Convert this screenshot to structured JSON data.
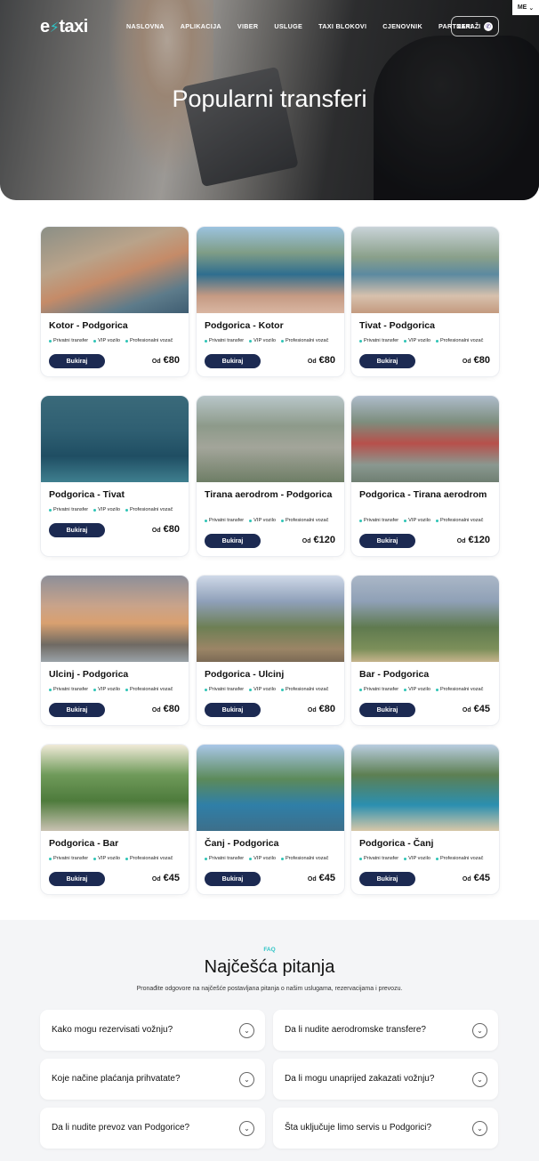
{
  "brand": {
    "logo_prefix": "e",
    "logo_suffix": "taxi",
    "accent": "#2ec4c6",
    "navy": "#1c2a52"
  },
  "nav": {
    "items": [
      "NASLOVNA",
      "APLIKACIJA",
      "VIBER",
      "USLUGE",
      "TAXI BLOKOVI",
      "CJENOVNIK",
      "PARTNERI"
    ],
    "order_label": "ZAKAŽI",
    "order_icon": "viber-icon",
    "language": "ME"
  },
  "hero": {
    "title": "Popularni transferi"
  },
  "transfers": [
    {
      "route": "Kotor - Podgorica",
      "price_prefix": "Od",
      "price": "€80"
    },
    {
      "route": "Podgorica - Kotor",
      "price_prefix": "Od",
      "price": "€80"
    },
    {
      "route": "Tivat - Podgorica",
      "price_prefix": "Od",
      "price": "€80"
    },
    {
      "route": "Podgorica - Tivat",
      "price_prefix": "Od",
      "price": "€80"
    },
    {
      "route": "Tirana aerodrom - Podgorica",
      "price_prefix": "Od",
      "price": "€120"
    },
    {
      "route": "Podgorica - Tirana aerodrom",
      "price_prefix": "Od",
      "price": "€120"
    },
    {
      "route": "Ulcinj - Podgorica",
      "price_prefix": "Od",
      "price": "€80"
    },
    {
      "route": "Podgorica - Ulcinj",
      "price_prefix": "Od",
      "price": "€80"
    },
    {
      "route": "Bar - Podgorica",
      "price_prefix": "Od",
      "price": "€45"
    },
    {
      "route": "Podgorica - Bar",
      "price_prefix": "Od",
      "price": "€45"
    },
    {
      "route": "Čanj - Podgorica",
      "price_prefix": "Od",
      "price": "€45"
    },
    {
      "route": "Podgorica - Čanj",
      "price_prefix": "Od",
      "price": "€45"
    }
  ],
  "card_common": {
    "tags": [
      "Privatni transfer",
      "VIP vozilo",
      "Profesionalni vozač"
    ],
    "book_label": "Bukiraj"
  },
  "faq": {
    "kicker": "FAQ",
    "title": "Najčešća pitanja",
    "subtitle": "Pronađite odgovore na najčešće postavljana pitanja o našim uslugama, rezervacijama i prevozu.",
    "questions": [
      "Kako mogu rezervisati vožnju?",
      "Da li nudite aerodromske transfere?",
      "Koje načine plaćanja prihvatate?",
      "Da li mogu unaprijed zakazati vožnju?",
      "Da li nudite prevoz van Podgorice?",
      "Šta uključuje limo servis u Podgorici?"
    ]
  }
}
